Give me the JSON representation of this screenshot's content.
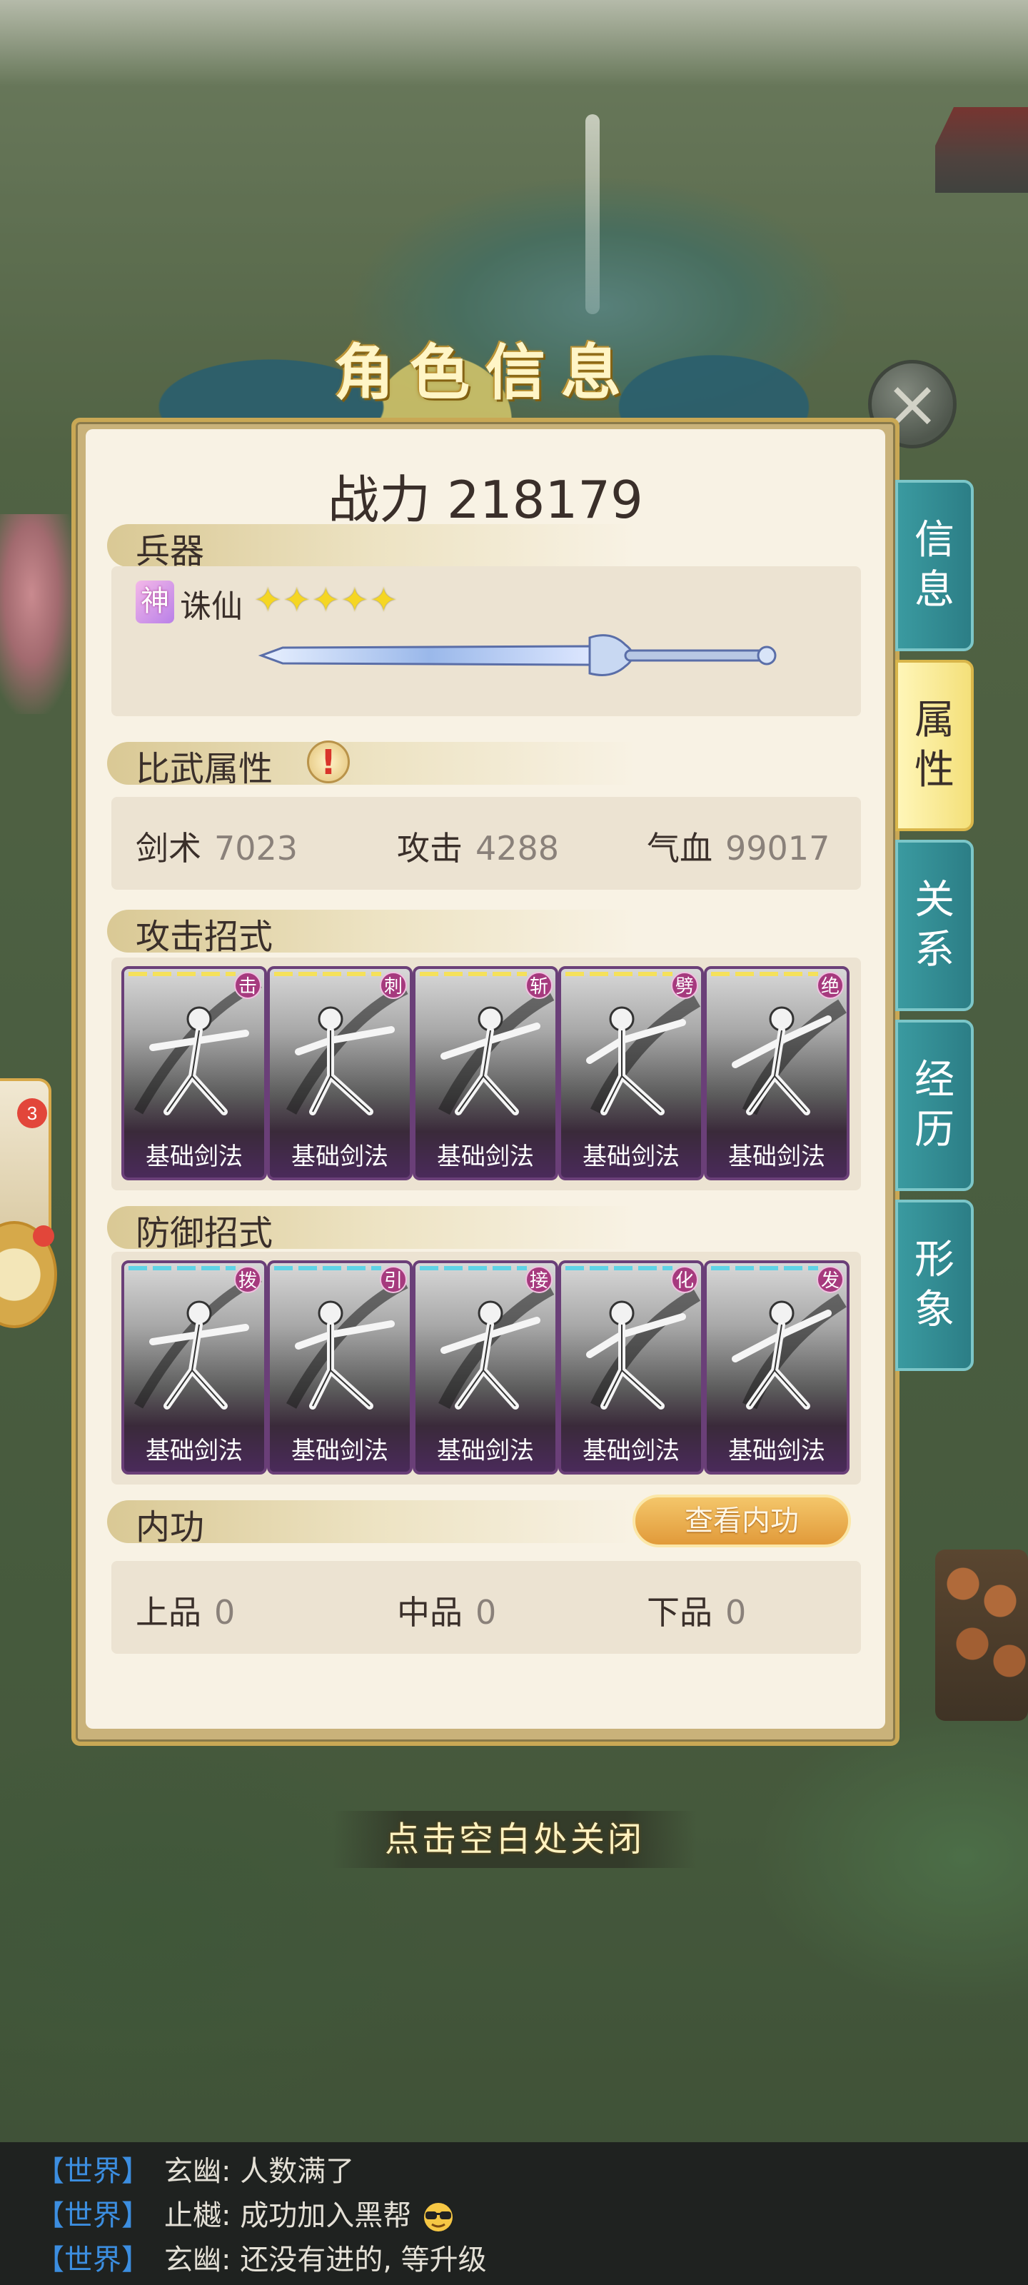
{
  "dialog": {
    "title": "角色信息",
    "power_label": "战力",
    "power_value": "218179",
    "close_hint": "点击空白处关闭"
  },
  "weapon": {
    "section_label": "兵器",
    "badge": "神",
    "name": "诛仙",
    "stars": "✦✦✦✦✦",
    "star_count": 5
  },
  "attributes": {
    "section_label": "比武属性",
    "alert": "!",
    "stats": [
      {
        "label": "剑术",
        "value": "7023"
      },
      {
        "label": "攻击",
        "value": "4288"
      },
      {
        "label": "气血",
        "value": "99017"
      }
    ]
  },
  "attack": {
    "section_label": "攻击招式",
    "bar_color": "#f5e15a",
    "skills": [
      {
        "corner": "击",
        "name": "基础剑法"
      },
      {
        "corner": "刺",
        "name": "基础剑法"
      },
      {
        "corner": "斩",
        "name": "基础剑法"
      },
      {
        "corner": "劈",
        "name": "基础剑法"
      },
      {
        "corner": "绝",
        "name": "基础剑法"
      }
    ]
  },
  "defense": {
    "section_label": "防御招式",
    "bar_color": "#5fd3e6",
    "skills": [
      {
        "corner": "拨",
        "name": "基础剑法"
      },
      {
        "corner": "引",
        "name": "基础剑法"
      },
      {
        "corner": "接",
        "name": "基础剑法"
      },
      {
        "corner": "化",
        "name": "基础剑法"
      },
      {
        "corner": "发",
        "name": "基础剑法"
      }
    ]
  },
  "neigong": {
    "section_label": "内功",
    "view_button": "查看内功",
    "grades": [
      {
        "label": "上品",
        "value": "0"
      },
      {
        "label": "中品",
        "value": "0"
      },
      {
        "label": "下品",
        "value": "0"
      }
    ]
  },
  "tabs": [
    {
      "line1": "信",
      "line2": "息",
      "active": false
    },
    {
      "line1": "属",
      "line2": "性",
      "active": true
    },
    {
      "line1": "关",
      "line2": "系",
      "active": false
    },
    {
      "line1": "经",
      "line2": "历",
      "active": false
    },
    {
      "line1": "形",
      "line2": "象",
      "active": false
    }
  ],
  "side_npc": {
    "badge": "3"
  },
  "chat": [
    {
      "channel": "【世界】",
      "text": "玄幽: 人数满了",
      "emoji": ""
    },
    {
      "channel": "【世界】",
      "text": "止樾: 成功加入黑帮",
      "emoji": "sunglasses-emoji"
    },
    {
      "channel": "【世界】",
      "text": "玄幽: 还没有进的, 等升级",
      "emoji": ""
    }
  ],
  "colors": {
    "tab_teal": "#2c7e86",
    "tab_active": "#f4e07a",
    "chat_channel": "#3c8ee0",
    "skill_frame": "#6a3f78"
  }
}
